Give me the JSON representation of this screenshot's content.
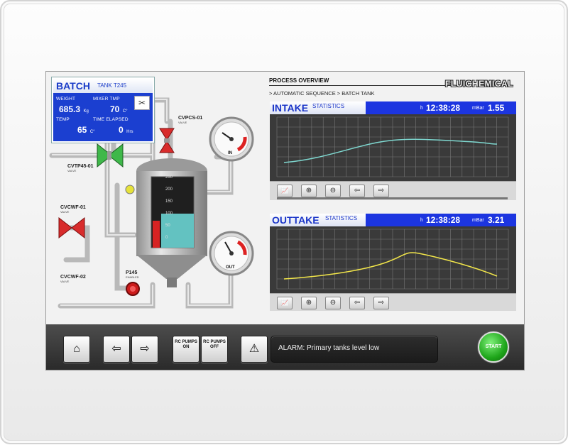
{
  "batch": {
    "title": "BATCH",
    "tank": "TANK T245",
    "weight_label": "WEIGHT",
    "weight_value": "685.3",
    "weight_unit": "Kg",
    "mixer_label": "MIXER TMP",
    "mixer_value": "70",
    "mixer_unit": "C°",
    "temp_label": "TEMP",
    "temp_value": "65",
    "temp_unit": "C°",
    "elapsed_label": "TIME ELAPSED",
    "elapsed_value": "0",
    "elapsed_unit": "Hrs"
  },
  "valves": {
    "cvpcs": "CVPCS-01",
    "cvpcs_sub": "VALVE",
    "cvtp": "CVTP45-01",
    "cvtp_sub": "VALVE",
    "cvcwf1": "CVCWF-01",
    "cvcwf1_sub": "VALVE",
    "cvcwf2": "CVCWF-02",
    "cvcwf2_sub": "VALVE",
    "pump": "P145",
    "pump_sub": "ENABLED"
  },
  "tank_scale": [
    "250",
    "200",
    "150",
    "100",
    "50",
    "0"
  ],
  "tank_level": 0.48,
  "gauges": {
    "in_label": "IN",
    "out_label": "OUT"
  },
  "process": {
    "title": "PROCESS OVERVIEW",
    "sequence": "> AUTOMATIC SEQUENCE  > BATCH TANK",
    "brand": "FLUICHEMICAL"
  },
  "intake": {
    "name": "INTAKE",
    "stat": "STATISTICS",
    "h": "h",
    "time": "12:38:28",
    "mbar": "mBar",
    "pressure": "1.55",
    "line_color": "#7fd8d0"
  },
  "outtake": {
    "name": "OUTTAKE",
    "stat": "STATISTICS",
    "h": "h",
    "time": "12:38:28",
    "mbar": "mBar",
    "pressure": "3.21",
    "line_color": "#f2e64a"
  },
  "toolbar": {
    "rc_on": "RC PUMPS ON",
    "rc_off": "RC PUMPS OFF",
    "alarm": "ALARM: Primary tanks level low",
    "start": "START"
  },
  "icons": {
    "home": "⌂",
    "prev": "⇦",
    "next": "⇨",
    "warning": "⚠",
    "chart": "📈",
    "zoom_in": "⊕",
    "zoom_out": "⊖",
    "tools": "✂"
  }
}
